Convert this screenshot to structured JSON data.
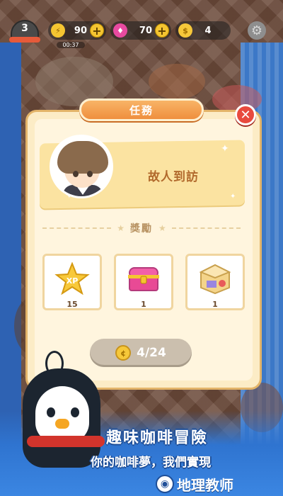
{
  "hud": {
    "level": "3",
    "energy": {
      "value": "90",
      "timer": "00:37"
    },
    "gems": {
      "value": "70"
    },
    "coins": {
      "value": "4"
    }
  },
  "dialog": {
    "title": "任務",
    "quest_name": "故人到訪",
    "rewards_label": "獎勵",
    "rewards": [
      {
        "name": "xp-star",
        "icon_text": "XP",
        "count": "15"
      },
      {
        "name": "treasure-chest",
        "icon_text": "",
        "count": "1"
      },
      {
        "name": "package-box",
        "icon_text": "",
        "count": "1"
      }
    ],
    "progress": {
      "text": "4/24"
    }
  },
  "promo": {
    "slogan": "趣味咖啡冒險",
    "subslogan": "你的咖啡夢，我們實現"
  },
  "watermark": {
    "text": "地理教师"
  },
  "colors": {
    "title_orange": "#ef8f3e",
    "close_red": "#e84a3e",
    "panel_cream": "#fcecc6",
    "banner_blue": "#3b86e2"
  }
}
